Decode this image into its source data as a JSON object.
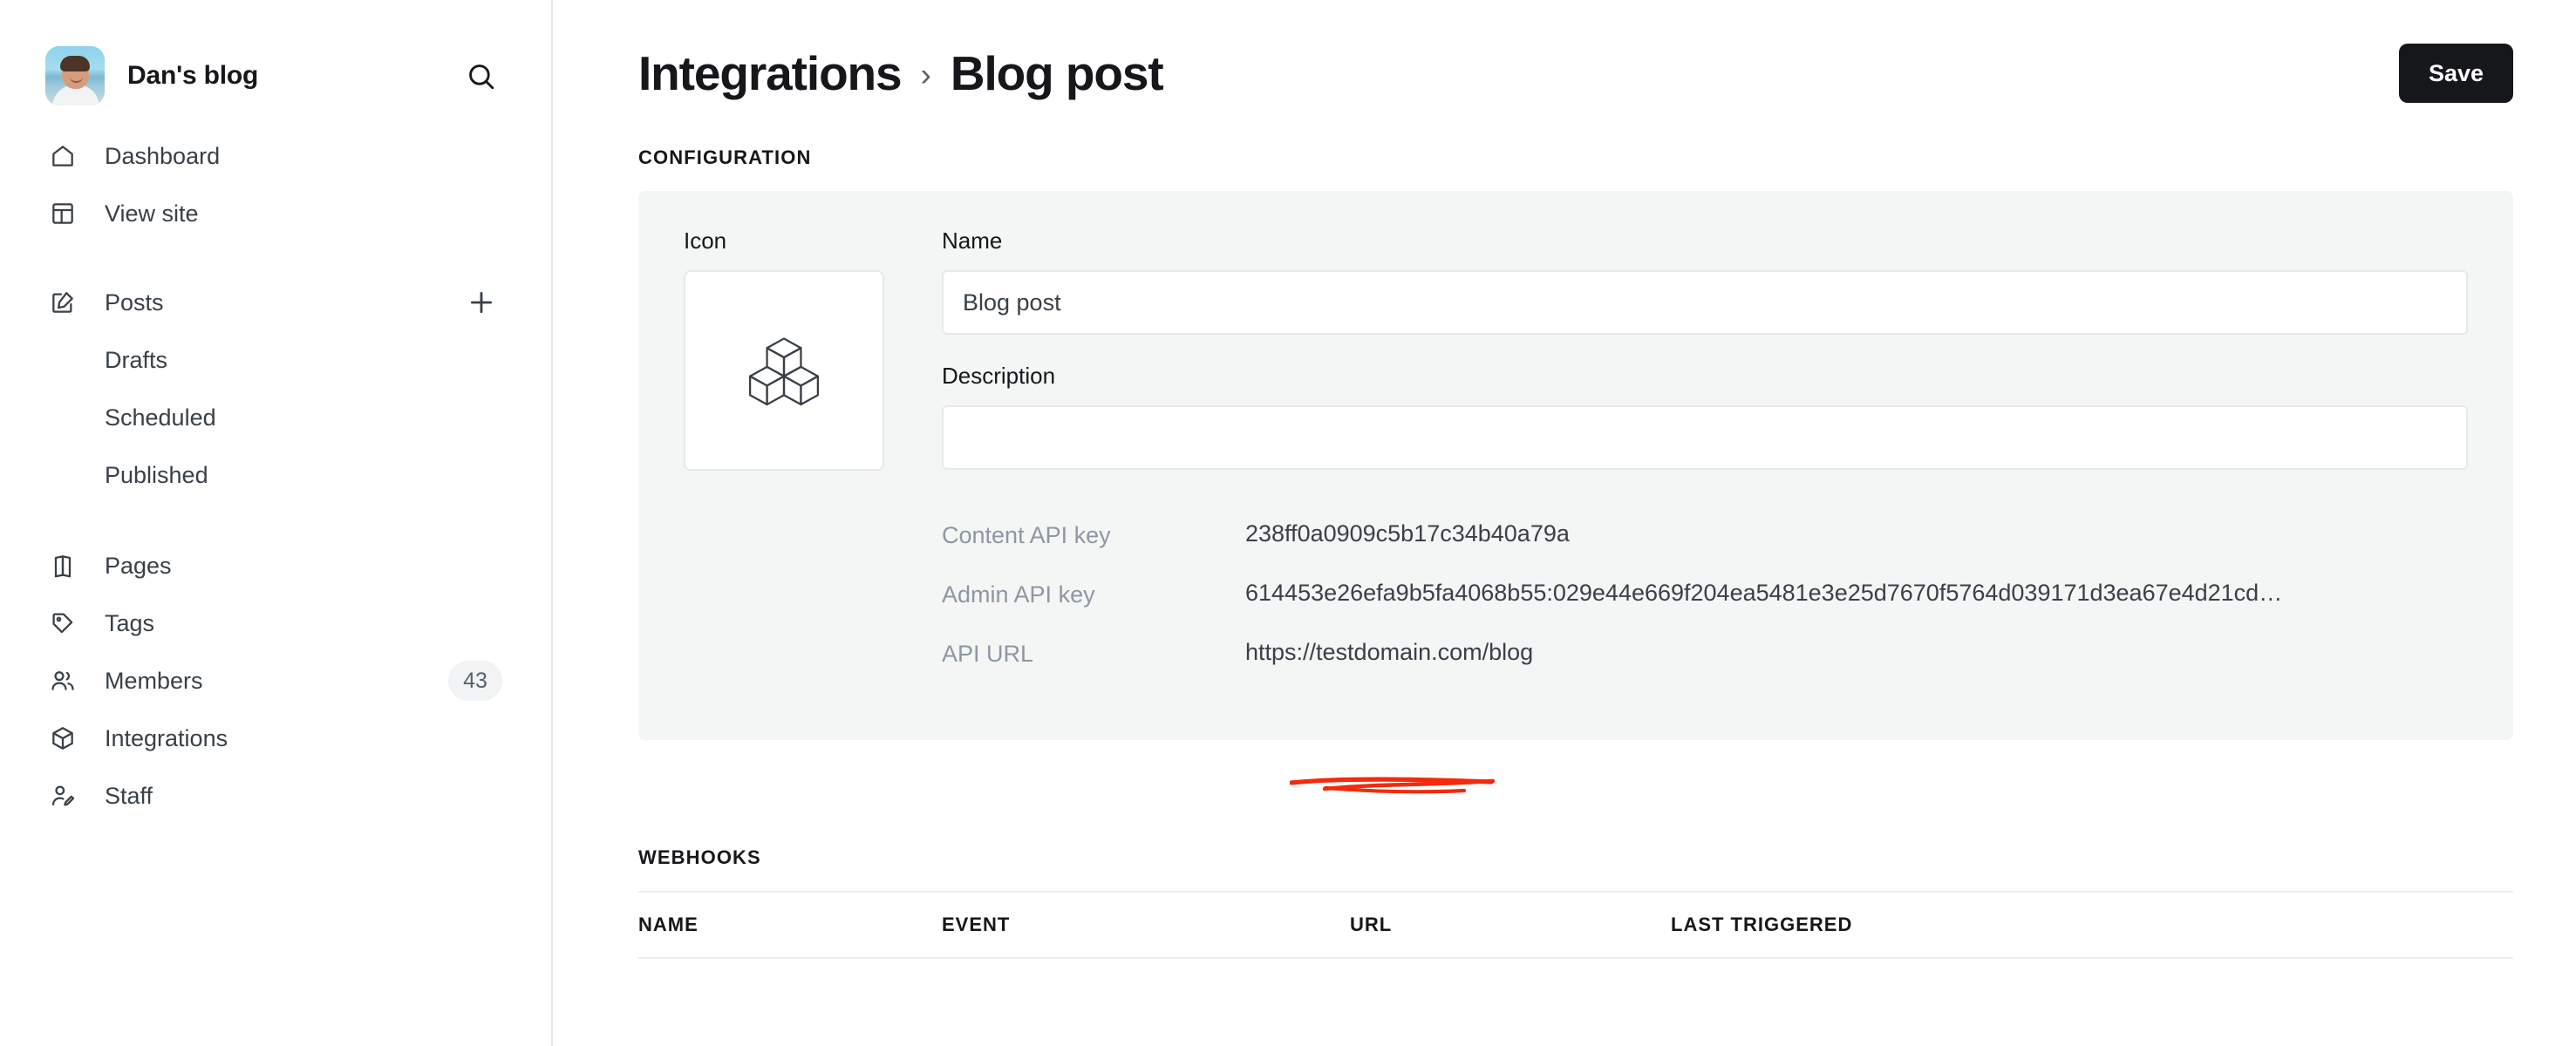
{
  "sidebar": {
    "brand": {
      "name": "Dan's blog",
      "avatar_icon": "user-avatar"
    },
    "search_icon": "search-icon",
    "nav": [
      {
        "label": "Dashboard",
        "icon": "home-icon"
      },
      {
        "label": "View site",
        "icon": "layout-icon"
      }
    ],
    "posts": {
      "label": "Posts",
      "icon": "edit-icon",
      "add_icon": "plus-icon",
      "children": [
        {
          "label": "Drafts"
        },
        {
          "label": "Scheduled"
        },
        {
          "label": "Published"
        }
      ]
    },
    "nav2": [
      {
        "label": "Pages",
        "icon": "pages-icon",
        "badge": ""
      },
      {
        "label": "Tags",
        "icon": "tag-icon",
        "badge": ""
      },
      {
        "label": "Members",
        "icon": "members-icon",
        "badge": "43"
      },
      {
        "label": "Integrations",
        "icon": "cube-icon",
        "badge": ""
      },
      {
        "label": "Staff",
        "icon": "staff-icon",
        "badge": ""
      }
    ]
  },
  "header": {
    "breadcrumb_parent": "Integrations",
    "breadcrumb_separator": "›",
    "breadcrumb_current": "Blog post",
    "save_label": "Save"
  },
  "configuration": {
    "section_label": "Configuration",
    "icon_label": "Icon",
    "icon_glyph": "cubes-icon",
    "name_label": "Name",
    "name_value": "Blog post",
    "name_placeholder": "",
    "description_label": "Description",
    "description_value": "",
    "description_placeholder": "",
    "keys": [
      {
        "label": "Content API key",
        "value": "238ff0a0909c5b17c34b40a79a",
        "annotated": true
      },
      {
        "label": "Admin API key",
        "value": "614453e26efa9b5fa4068b55:029e44e669f204ea5481e3e25d7670f5764d039171d3ea67e4d21cd…",
        "annotated": false
      },
      {
        "label": "API URL",
        "value": "https://testdomain.com/blog",
        "annotated": false
      }
    ]
  },
  "webhooks": {
    "section_label": "Webhooks",
    "columns": [
      "Name",
      "Event",
      "URL",
      "Last triggered"
    ],
    "rows": []
  },
  "annotation": {
    "type": "red-underline",
    "color": "#f32a0c",
    "target": "Content API key"
  }
}
